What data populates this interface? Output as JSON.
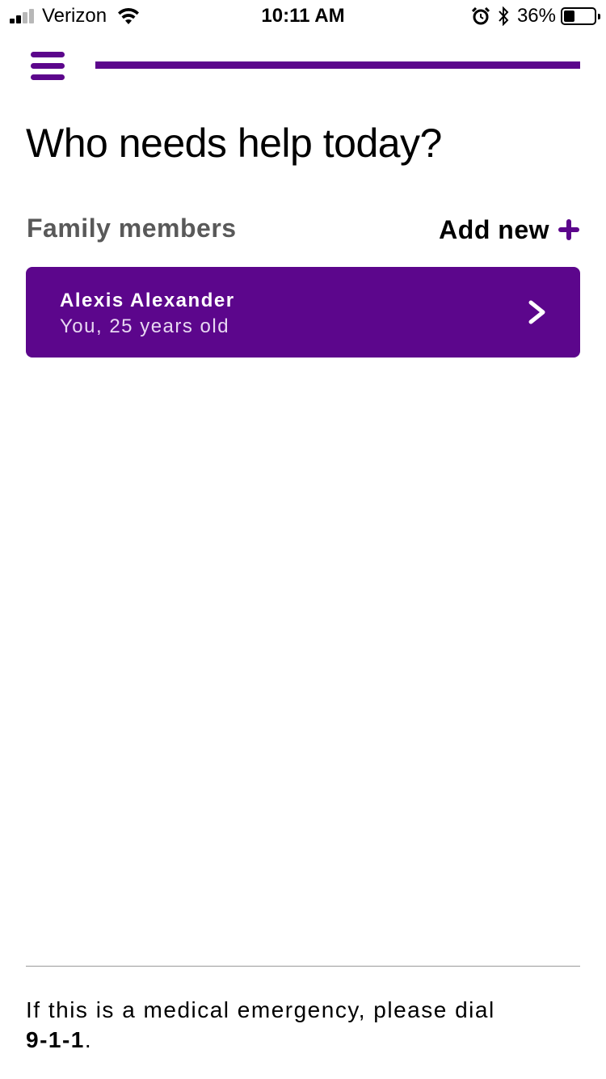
{
  "status_bar": {
    "carrier": "Verizon",
    "time": "10:11 AM",
    "battery_percent": "36%",
    "battery_level": 0.36,
    "icons": [
      "signal-icon",
      "wifi-icon",
      "alarm-icon",
      "bluetooth-icon",
      "battery-icon"
    ]
  },
  "header": {
    "menu_icon": "hamburger-menu-icon",
    "accent_color": "#5c068c",
    "progress_level": 1.0
  },
  "title": "Who needs help today?",
  "family": {
    "section_label": "Family members",
    "add_new_label": "Add new",
    "add_icon": "plus-icon",
    "members": [
      {
        "name": "Alexis Alexander",
        "subtitle": "You, 25 years old",
        "icon": "chevron-right-icon"
      }
    ]
  },
  "footer": {
    "emergency_text": "If this is a medical emergency, please dial",
    "emergency_number": "9-1-1",
    "emergency_suffix": "."
  }
}
